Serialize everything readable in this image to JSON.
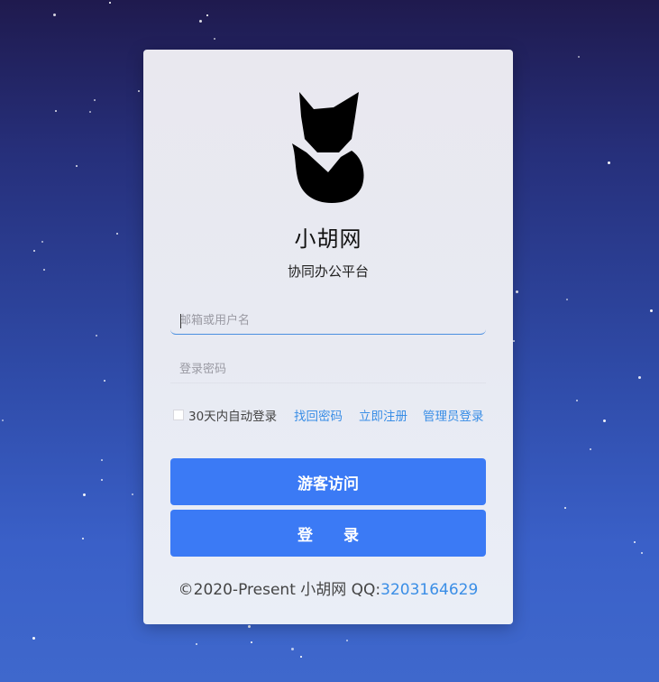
{
  "logo": {
    "icon": "fox-logo-icon"
  },
  "site": {
    "title": "小胡网",
    "subtitle": "协同办公平台"
  },
  "form": {
    "username_placeholder": "邮箱或用户名",
    "password_placeholder": "登录密码",
    "remember_label": "30天内自动登录",
    "forgot_password": "找回密码",
    "register": "立即注册",
    "admin_login": "管理员登录"
  },
  "buttons": {
    "guest": "游客访问",
    "login": "登 录"
  },
  "footer": {
    "copyright": "©2020-Present 小胡网 QQ:",
    "qq": "3203164629"
  },
  "colors": {
    "primary_button": "#3b7af5",
    "link": "#3a8ee6",
    "background_top": "#1f1a4e",
    "background_bottom": "#3f68cc"
  }
}
